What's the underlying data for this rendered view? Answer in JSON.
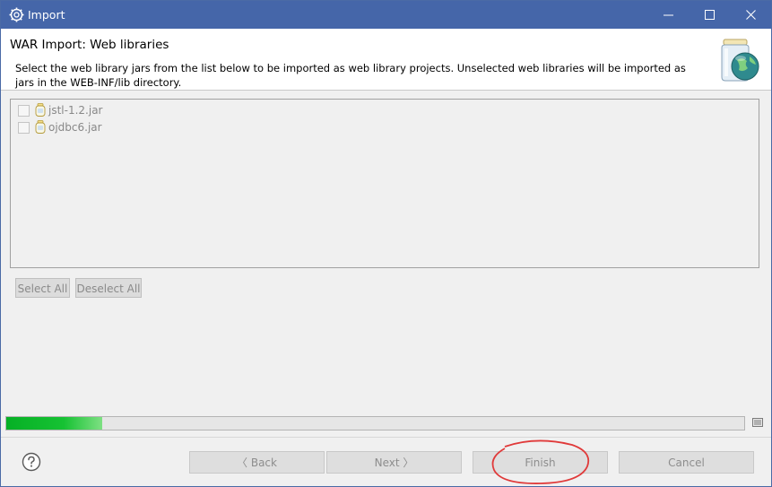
{
  "window": {
    "title": "Import",
    "icon": "eclipse-gear-icon",
    "controls": {
      "minimize": "minimize-icon",
      "maximize": "maximize-icon",
      "close": "close-icon"
    }
  },
  "header": {
    "title": "WAR Import: Web libraries",
    "description": "Select the web library jars from the list below to be imported as web library projects.  Unselected web libraries will be imported as jars in the WEB-INF/lib directory.",
    "graphic": "jar-globe-icon"
  },
  "libraries": [
    {
      "name": "jstl-1.2.jar",
      "checked": false,
      "icon": "jar-icon"
    },
    {
      "name": "ojdbc6.jar",
      "checked": false,
      "icon": "jar-icon"
    }
  ],
  "list_buttons": {
    "select_all": "Select All",
    "deselect_all": "Deselect All"
  },
  "progress": {
    "fraction": 0.13,
    "fill_color": "#06b025"
  },
  "footer": {
    "help_icon": "help-icon",
    "back": "〈 Back",
    "next": "Next 〉",
    "finish": "Finish",
    "cancel": "Cancel"
  },
  "colors": {
    "titlebar": "#4566a9",
    "annotation": "#e03a3a"
  }
}
